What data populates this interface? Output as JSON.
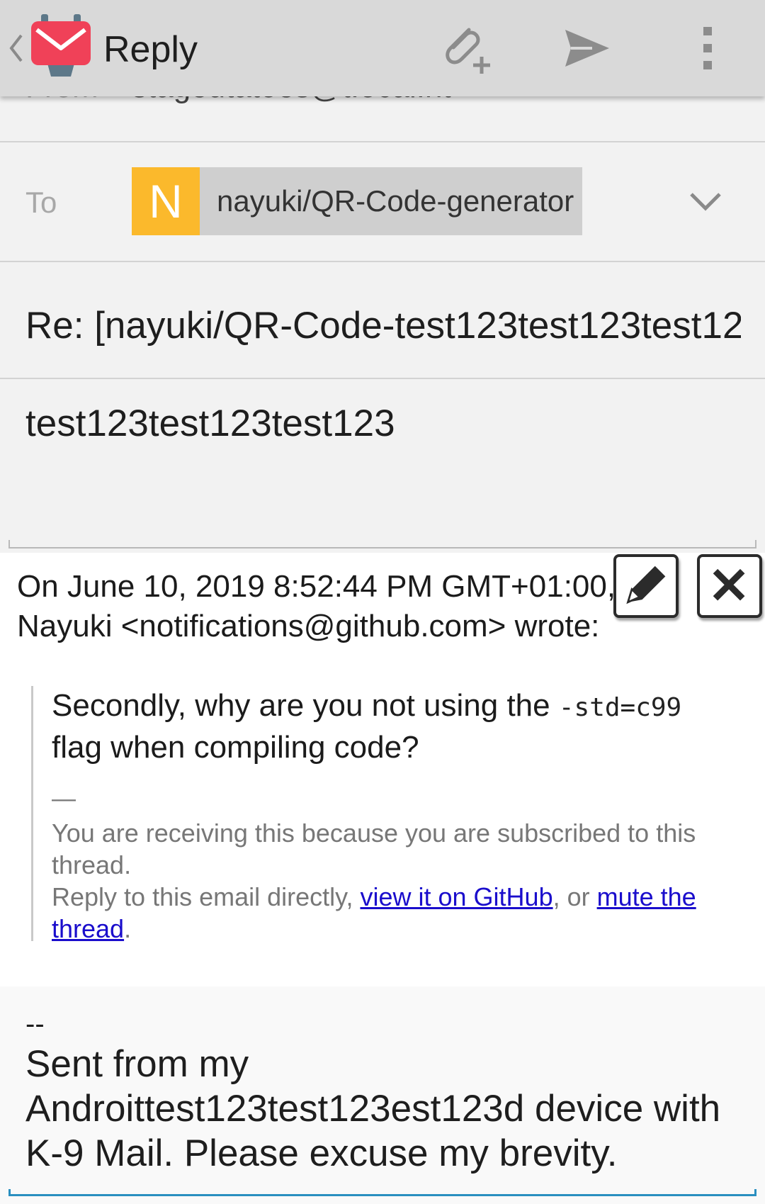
{
  "actionbar": {
    "title": "Reply",
    "icons": {
      "up": "chevron-left-icon",
      "logo": "k9-mail-logo",
      "attach": "paperclip-plus-icon",
      "send": "send-icon",
      "menu": "overflow-menu-icon"
    }
  },
  "from": {
    "label": "From",
    "value": "stageutatoes@t.ocal.nt"
  },
  "to": {
    "label": "To",
    "recipient": {
      "initial": "N",
      "name": "nayuki/QR-Code-generator"
    }
  },
  "subject": "Re: [nayuki/QR-Code-test123test123test12",
  "message": "test123test123test123",
  "quote": {
    "header_line1": "On June 10, 2019 8:52:44 PM GMT+01:00,",
    "header_line2": "Nayuki <notifications@github.com> wrote:",
    "text_before_code": "Secondly, why are you not using the ",
    "code": "-std=c99",
    "text_after_code": "flag when compiling code?",
    "dash": "—",
    "note": "You are receiving this because you are subscribed to this thread.",
    "reply_prefix": "Reply to this email directly, ",
    "link_view": "view it on GitHub",
    "reply_middle": ", or ",
    "link_mute": "mute the thread",
    "reply_suffix": "."
  },
  "signature": {
    "dashes": "--",
    "text": "Sent from my Androittest123test123est123d device with K-9 Mail. Please excuse my brevity."
  },
  "colors": {
    "actionbar_bg": "#d9d9d9",
    "chip_avatar": "#fbb92c",
    "link": "#1a0dcc",
    "logo_red": "#f04158",
    "focus_underline": "#2a8fc0"
  }
}
